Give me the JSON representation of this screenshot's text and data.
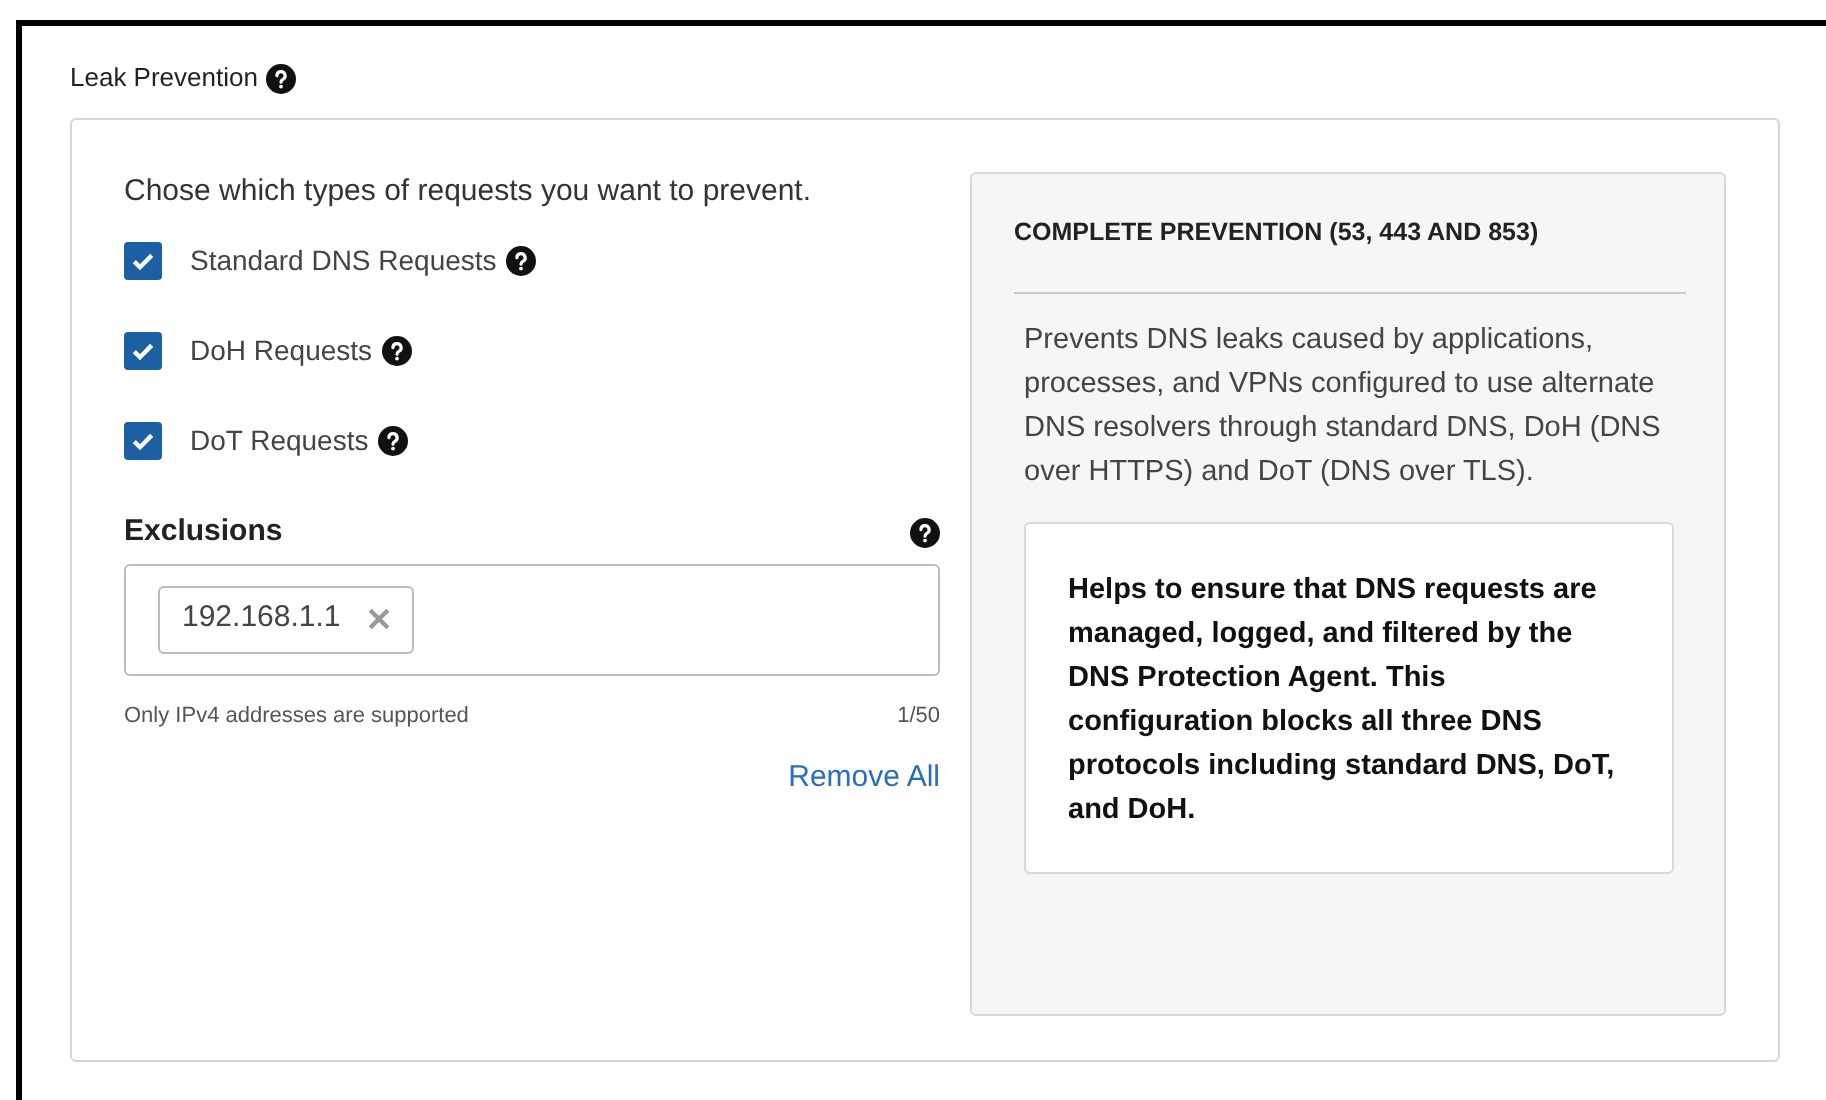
{
  "section": {
    "title": "Leak Prevention"
  },
  "instruction": "Chose which types of requests you want to prevent.",
  "options": [
    {
      "label": "Standard DNS Requests",
      "checked": true
    },
    {
      "label": "DoH Requests",
      "checked": true
    },
    {
      "label": "DoT Requests",
      "checked": true
    }
  ],
  "exclusions": {
    "label": "Exclusions",
    "chips": [
      "192.168.1.1"
    ],
    "hint": "Only IPv4 addresses are supported",
    "count": "1/50",
    "remove_all": "Remove All"
  },
  "info_panel": {
    "title": "COMPLETE PREVENTION (53, 443 AND 853)",
    "description": "Prevents DNS leaks caused by applications, processes, and VPNs configured to use alternate DNS resolvers through standard DNS, DoH (DNS over HTTPS) and DoT (DNS over TLS).",
    "note": "Helps to ensure that DNS requests are managed, logged, and filtered by the DNS Protection Agent. This configuration blocks all three DNS protocols including standard DNS, DoT, and DoH."
  }
}
